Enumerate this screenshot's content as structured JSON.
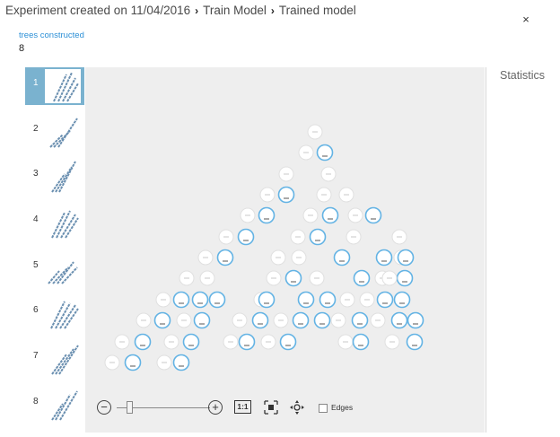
{
  "header": {
    "breadcrumb": [
      "Experiment created on 11/04/2016",
      "Train Model",
      "Trained model"
    ],
    "separator": "›",
    "close_icon": "×"
  },
  "trees": {
    "label": "trees constructed",
    "value": "8"
  },
  "thumbnails": [
    {
      "label": "1",
      "selected": true
    },
    {
      "label": "2",
      "selected": false
    },
    {
      "label": "3",
      "selected": false
    },
    {
      "label": "4",
      "selected": false
    },
    {
      "label": "5",
      "selected": false
    },
    {
      "label": "6",
      "selected": false
    },
    {
      "label": "7",
      "selected": false
    },
    {
      "label": "8",
      "selected": false
    }
  ],
  "statistics": {
    "title": "Statistics"
  },
  "toolbar": {
    "zoom_out": "−",
    "zoom_in": "+",
    "actual_size": "1:1",
    "edges_label": "Edges",
    "edges_checked": false
  },
  "colors": {
    "selected_thumb_bg": "#7ab2cf",
    "leaf_stroke": "#63b3e4",
    "canvas_bg": "#eeeeee",
    "link": "#2b8fd6"
  }
}
